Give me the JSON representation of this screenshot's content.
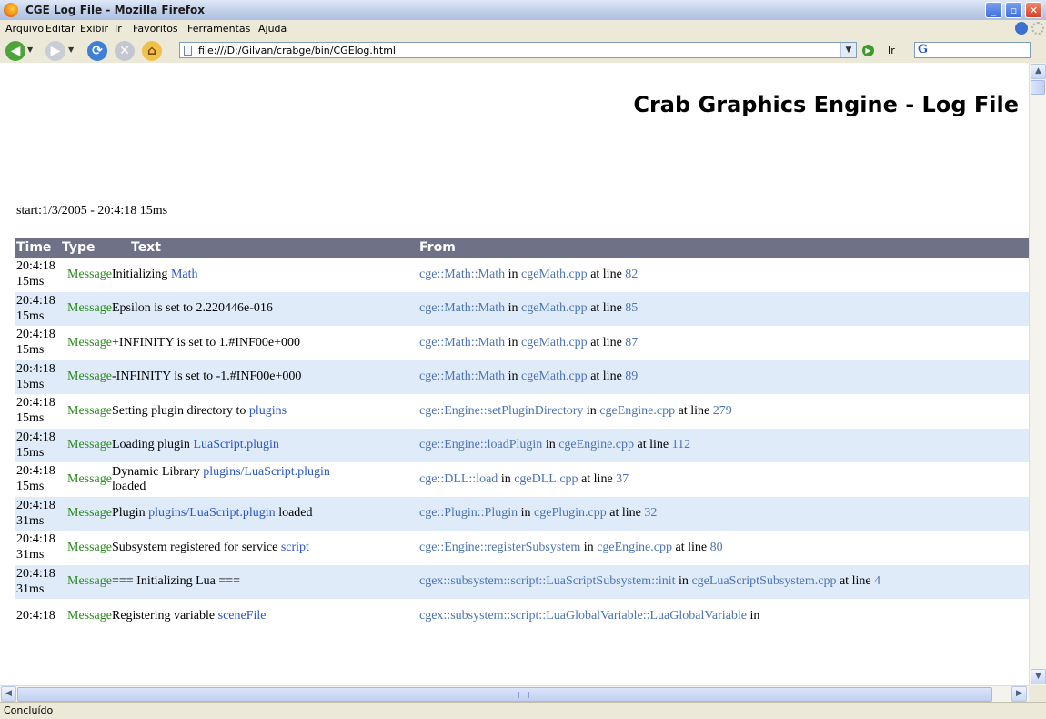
{
  "window": {
    "title": "CGE Log File - Mozilla Firefox"
  },
  "menu": [
    "Arquivo",
    "Editar",
    "Exibir",
    "Ir",
    "Favoritos",
    "Ferramentas",
    "Ajuda"
  ],
  "nav": {
    "url": "file:///D:/Gilvan/crabge/bin/CGElog.html",
    "go_label": "Ir"
  },
  "page": {
    "title": "Crab Graphics Engine - Log File",
    "start": "start:1/3/2005 - 20:4:18 15ms",
    "columns": {
      "time": "Time",
      "type": "Type",
      "text": "Text",
      "from": "From"
    },
    "rows": [
      {
        "time": "20:4:18",
        "ms": "15ms",
        "type": "Message",
        "text": "Initializing ",
        "arg": "Math",
        "from_fn": "cge::Math::Math",
        "in": " in ",
        "file": "cgeMath.cpp",
        "at": " at line ",
        "line": "82"
      },
      {
        "time": "20:4:18",
        "ms": "15ms",
        "type": "Message",
        "text": "Epsilon is set to 2.220446e-016",
        "arg": "",
        "from_fn": "cge::Math::Math",
        "in": " in ",
        "file": "cgeMath.cpp",
        "at": " at line ",
        "line": "85"
      },
      {
        "time": "20:4:18",
        "ms": "15ms",
        "type": "Message",
        "text": "+INFINITY is set to 1.#INF00e+000",
        "arg": "",
        "from_fn": "cge::Math::Math",
        "in": " in ",
        "file": "cgeMath.cpp",
        "at": " at line ",
        "line": "87"
      },
      {
        "time": "20:4:18",
        "ms": "15ms",
        "type": "Message",
        "text": "-INFINITY is set to -1.#INF00e+000",
        "arg": "",
        "from_fn": "cge::Math::Math",
        "in": " in ",
        "file": "cgeMath.cpp",
        "at": " at line ",
        "line": "89"
      },
      {
        "time": "20:4:18",
        "ms": "15ms",
        "type": "Message",
        "text": "Setting plugin directory to ",
        "arg": "plugins",
        "from_fn": "cge::Engine::setPluginDirectory",
        "in": " in ",
        "file": "cgeEngine.cpp",
        "at": " at line ",
        "line": "279"
      },
      {
        "time": "20:4:18",
        "ms": "15ms",
        "type": "Message",
        "text": "Loading plugin ",
        "arg": "LuaScript.plugin",
        "from_fn": "cge::Engine::loadPlugin",
        "in": " in ",
        "file": "cgeEngine.cpp",
        "at": " at line ",
        "line": "112"
      },
      {
        "time": "20:4:18",
        "ms": "15ms",
        "type": "Message",
        "text": "Dynamic Library ",
        "arg": "plugins/LuaScript.plugin",
        "text2": "loaded",
        "from_fn": "cge::DLL::load",
        "in": " in ",
        "file": "cgeDLL.cpp",
        "at": " at line ",
        "line": "37"
      },
      {
        "time": "20:4:18",
        "ms": "31ms",
        "type": "Message",
        "text": "Plugin ",
        "arg": "plugins/LuaScript.plugin",
        "text_after": " loaded",
        "from_fn": "cge::Plugin::Plugin",
        "in": " in ",
        "file": "cgePlugin.cpp",
        "at": " at line ",
        "line": "32"
      },
      {
        "time": "20:4:18",
        "ms": "31ms",
        "type": "Message",
        "text": "Subsystem registered for service ",
        "arg": "script",
        "from_fn": "cge::Engine::registerSubsystem",
        "in": " in ",
        "file": "cgeEngine.cpp",
        "at": " at line ",
        "line": "80"
      },
      {
        "time": "20:4:18",
        "ms": "31ms",
        "type": "Message",
        "text": "=== Initializing Lua ===",
        "arg": "",
        "from_fn": "cgex::subsystem::script::LuaScriptSubsystem::init",
        "in": " in ",
        "file": "cgeLuaScriptSubsystem.cpp",
        "at": " at line ",
        "line": "4"
      },
      {
        "time": "20:4:18",
        "ms": "",
        "type": "Message",
        "text": "Registering variable ",
        "arg": "sceneFile",
        "from_fn": "cgex::subsystem::script::LuaGlobalVariable::LuaGlobalVariable",
        "in": " in",
        "file": "",
        "at": "",
        "line": ""
      }
    ]
  },
  "status": "Concluído",
  "colors": {
    "header_bg": "#6f7287",
    "row_alt": "#dfebf9",
    "time": "#1e3ea6",
    "type": "#2b8c1e",
    "link": "#4c74b5"
  }
}
